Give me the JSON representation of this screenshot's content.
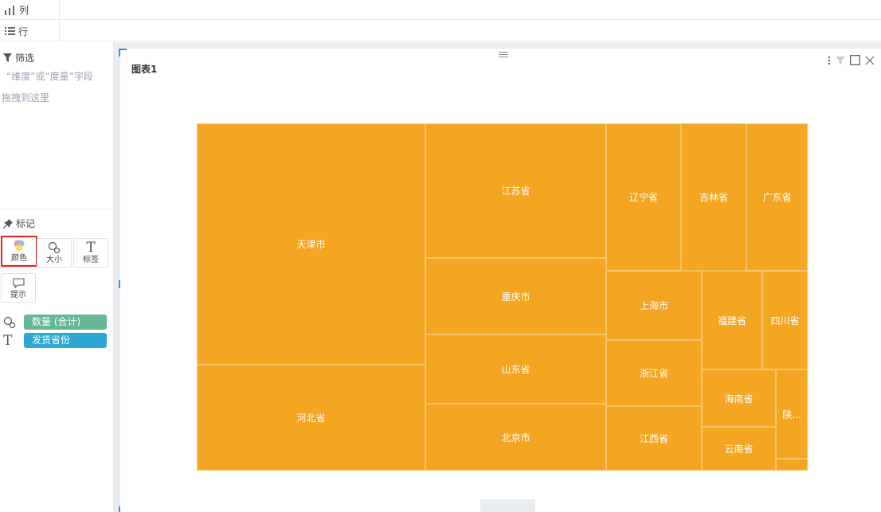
{
  "shelves": {
    "columns_label": "列",
    "rows_label": "行"
  },
  "filter": {
    "title": "筛选",
    "hint_line1": "“维度”或“度量”字段",
    "hint_line2": "拖拽到这里"
  },
  "marks": {
    "title": "标记",
    "buttons": [
      {
        "label": "颜色",
        "icon": "color-palette-icon"
      },
      {
        "label": "大小",
        "icon": "size-circles-icon"
      },
      {
        "label": "标签",
        "icon": "text-t-icon"
      },
      {
        "label": "提示",
        "icon": "tooltip-bubble-icon"
      }
    ],
    "fields": [
      {
        "label": "数量 (合计)",
        "icon": "size-circles-icon",
        "color": "#67b795"
      },
      {
        "label": "发货省份",
        "icon": "text-t-icon",
        "color": "#2da7d3"
      }
    ]
  },
  "chart": {
    "title": "图表1",
    "fill_color": "#f4a623"
  },
  "chart_data": {
    "type": "treemap",
    "value_field": "数量 (合计)",
    "label_field": "发货省份",
    "items": [
      "天津市",
      "河北省",
      "江苏省",
      "重庆市",
      "山东省",
      "北京市",
      "辽宁省",
      "吉林省",
      "广东省",
      "上海市",
      "浙江省",
      "江西省",
      "福建省",
      "四川省",
      "海南省",
      "云南省",
      "陕..."
    ]
  }
}
